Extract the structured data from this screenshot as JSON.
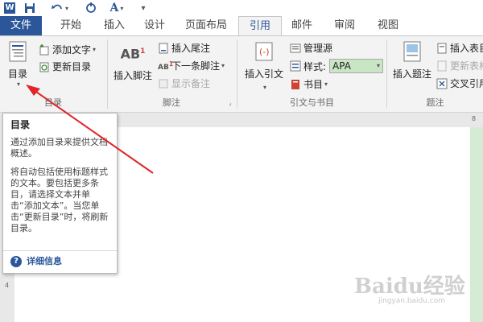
{
  "qat": {
    "logo": "W",
    "items": [
      "save-icon",
      "undo-icon",
      "redo-icon",
      "font-color-icon",
      "customize-icon"
    ]
  },
  "tabs": [
    "文件",
    "开始",
    "插入",
    "设计",
    "页面布局",
    "引用",
    "邮件",
    "审阅",
    "视图"
  ],
  "active_tab": "引用",
  "ribbon": {
    "toc": {
      "big_label": "目录",
      "add_text": "添加文字",
      "update_toc": "更新目录",
      "group_label": "目录"
    },
    "footnotes": {
      "insert_footnote": "插入脚注",
      "insert_endnote": "插入尾注",
      "next_footnote": "下一条脚注",
      "show_notes": "显示备注",
      "group_label": "脚注"
    },
    "citations": {
      "insert_citation": "插入引文",
      "manage_sources": "管理源",
      "style_label": "样式:",
      "style_value": "APA",
      "bibliography": "书目",
      "group_label": "引文与书目"
    },
    "captions": {
      "insert_caption": "插入题注",
      "insert_table_figures": "插入表目",
      "update_table": "更新表格",
      "cross_reference": "交叉引用",
      "group_label": "题注"
    }
  },
  "ruler_mark": "8",
  "vruler_mark": "4",
  "tooltip": {
    "title": "目录",
    "para1": "通过添加目录来提供文档概述。",
    "para2": "将自动包括使用标题样式的文本。要包括更多条目，请选择文本并单击“添加文本”。当您单击“更新目录”时，将刷新目录。",
    "more_info": "详细信息"
  },
  "watermark": {
    "main": "Baidu经验",
    "sub": "jingyan.baidu.com"
  },
  "colors": {
    "accent": "#2b579a",
    "arrow": "#e0262a",
    "style_box": "#c8e6c3"
  }
}
